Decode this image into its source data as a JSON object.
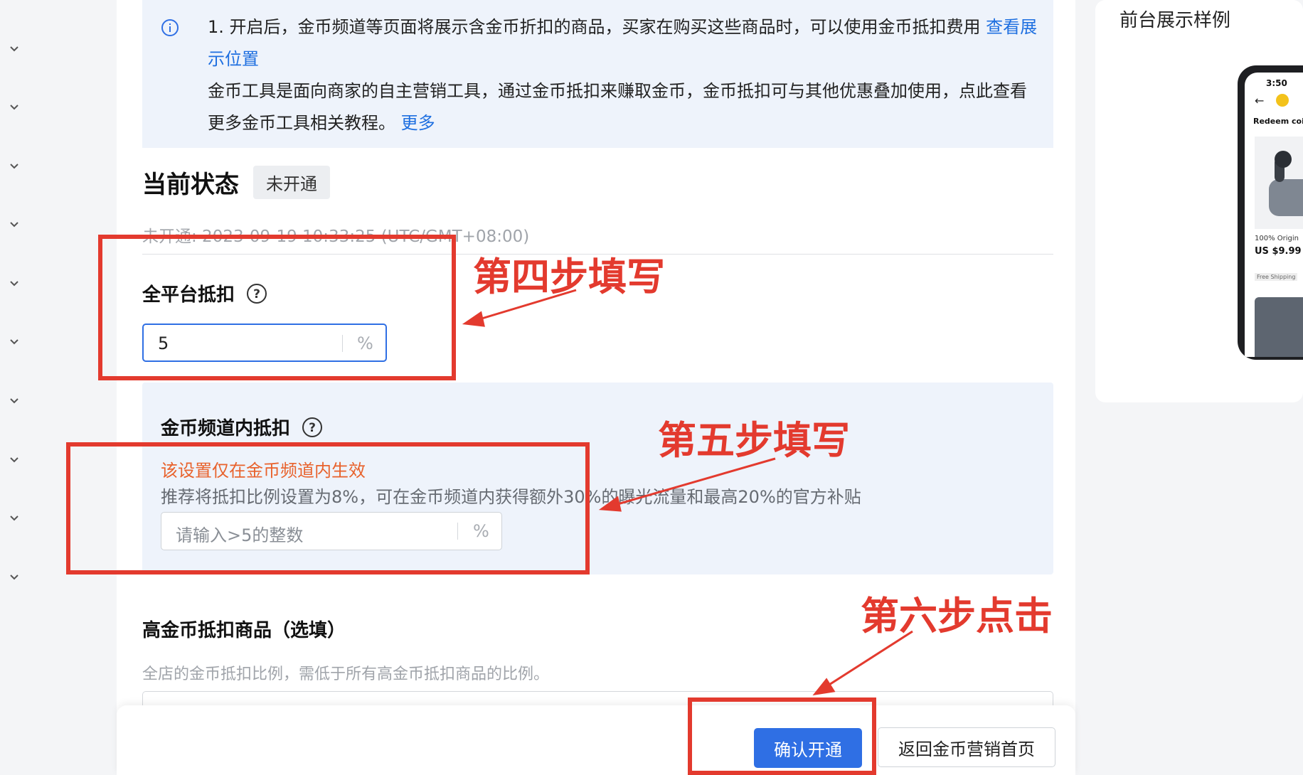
{
  "notice": {
    "line1": "1. 开启后，金币频道等页面将展示含金币折扣的商品，买家在购买这些商品时，可以使用金币抵扣费用 ",
    "line1_link": "查看展示位置",
    "line2": "金币工具是面向商家的自主营销工具，通过金币抵扣来赚取金币，金币抵扣可与其他优惠叠加使用，点此查看更多金币工具相关教程。 ",
    "line2_link": "更多"
  },
  "status": {
    "title": "当前状态",
    "badge": "未开通",
    "time": "未开通: 2023-09-19 10:33:25 (UTC/GMT+08:00)"
  },
  "platform_deduction": {
    "title": "全平台抵扣",
    "value": "5",
    "unit": "%"
  },
  "channel_deduction": {
    "title": "金币频道内抵扣",
    "warning": "该设置仅在金币频道内生效",
    "tip": "推荐将抵扣比例设置为8%，可在金币频道内获得额外30%的曝光流量和最高20%的官方补贴",
    "placeholder": "请输入>5的整数",
    "unit": "%"
  },
  "high_coin": {
    "title": "高金币抵扣商品（选填）",
    "desc": "全店的金币抵扣比例，需低于所有高金币抵扣商品的比例。"
  },
  "footer": {
    "confirm_label": "确认开通",
    "back_label": "返回金币营销首页"
  },
  "preview": {
    "title": "前台展示样例",
    "phone_time": "3:50",
    "redeem_text": "Redeem coi",
    "product_text": "100% Origin",
    "price": "US $9.99",
    "shipping": "Free Shipping"
  },
  "annotations": {
    "step4": "第四步填写",
    "step5": "第五步填写",
    "step6": "第六步点击"
  },
  "colors": {
    "accent": "#2f6fe4",
    "annotation_red": "#e33a2e",
    "warning_orange": "#e8622c",
    "panel_bg": "#eef3fb"
  }
}
